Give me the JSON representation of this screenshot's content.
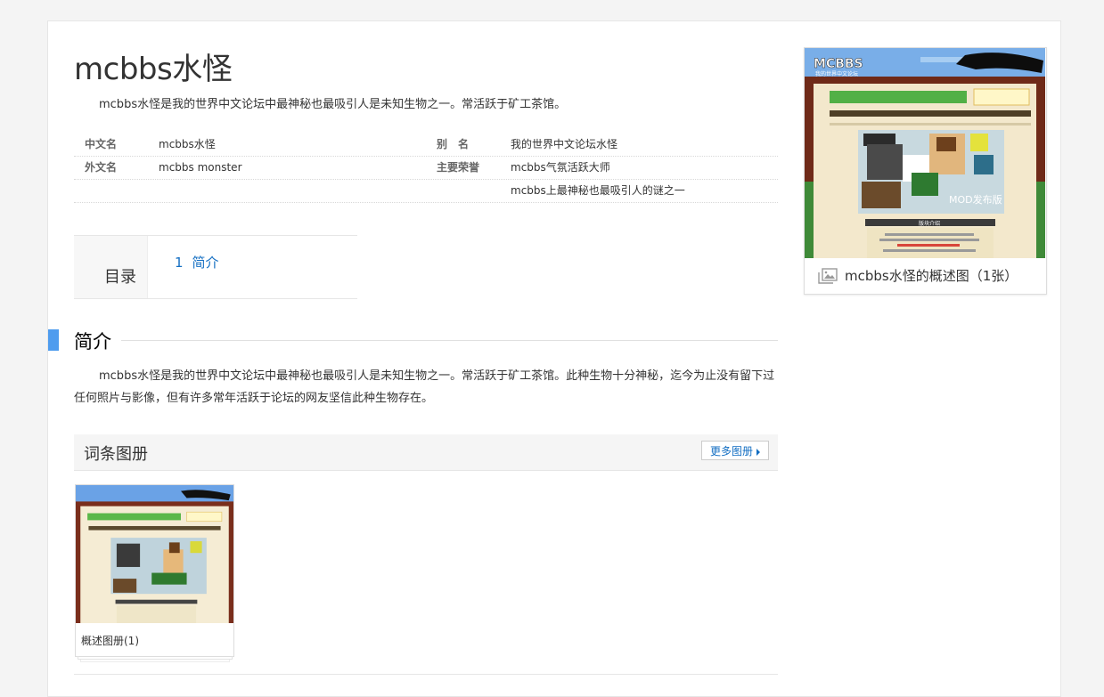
{
  "article": {
    "title": "mcbbs水怪",
    "summary": "mcbbs水怪是我的世界中文论坛中最神秘也最吸引人是未知生物之一。常活跃于矿工茶馆。"
  },
  "infobox": {
    "rows": [
      {
        "name": "中文名",
        "value": "mcbbs水怪",
        "name2": "别　名",
        "value2": "我的世界中文论坛水怪"
      },
      {
        "name": "外文名",
        "value": "mcbbs monster",
        "name2": "主要荣誉",
        "value2": "mcbbs气氛活跃大师"
      },
      {
        "name": "",
        "value": "",
        "name2": "",
        "value2": "mcbbs上最神秘也最吸引人的谜之一"
      }
    ]
  },
  "toc": {
    "label": "目录",
    "items": [
      {
        "num": "1",
        "label": "简介"
      }
    ]
  },
  "section": {
    "title": "简介",
    "text": "mcbbs水怪是我的世界中文论坛中最神秘也最吸引人是未知生物之一。常活跃于矿工茶馆。此种生物十分神秘，迄今为止没有留下过任何照片与影像，但有许多常年活跃于论坛的网友坚信此种生物存在。"
  },
  "album": {
    "title": "词条图册",
    "more_label": "更多图册",
    "card_caption": "概述图册(1)"
  },
  "side": {
    "caption": "mcbbs水怪的概述图（1张）",
    "screenshot_logo": "MCBBS",
    "screenshot_sub": "我的世界中文论坛",
    "screenshot_banner": "MOD发布版",
    "screenshot_box_title": "版块介绍"
  },
  "colors": {
    "link": "#136ec2",
    "accent": "#4f9cee"
  }
}
